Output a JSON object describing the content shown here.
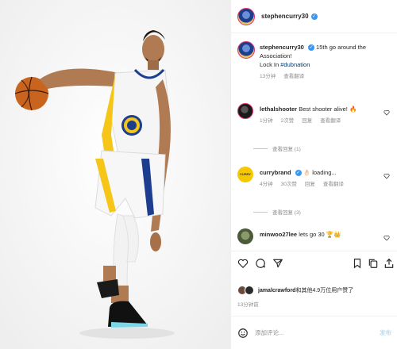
{
  "post": {
    "username": "stephencurry30",
    "verified_icon": "check-icon",
    "caption_user": "stephencurry30",
    "caption_text": "15th go around the Association!",
    "caption_line2": "Lock In ",
    "caption_hashtag": "#dubnation",
    "caption_time": "13分钟",
    "see_translation": "查看翻译",
    "photo_alt": "basketball player dribbling"
  },
  "comments": [
    {
      "username": "lethalshooter",
      "text": "Best shooter alive! 🔥",
      "time": "1分钟",
      "likes": "2次赞",
      "reply": "回复",
      "translate": "查看翻译",
      "view_replies": "查看回复 (1)"
    },
    {
      "username": "currybrand",
      "avatar_text": "CURRY",
      "text": "👌🏻 loading...",
      "time": "4分钟",
      "likes": "30次赞",
      "reply": "回复",
      "translate": "查看翻译",
      "view_replies": "查看回复 (3)"
    },
    {
      "username": "minwoo27lee",
      "text": "lets go 30 🏆👑"
    }
  ],
  "likes_line": {
    "user": "jamalcrawford",
    "rest": "和其他4.9万位用户赞了"
  },
  "post_time": "13分钟前",
  "compose": {
    "placeholder": "添加评论...",
    "post_label": "发布"
  },
  "colors": {
    "link": "#00376b",
    "meta": "#8e8e8e",
    "verified": "#3897f0",
    "warriors_blue": "#1d3d8f",
    "warriors_gold": "#f5c518"
  }
}
